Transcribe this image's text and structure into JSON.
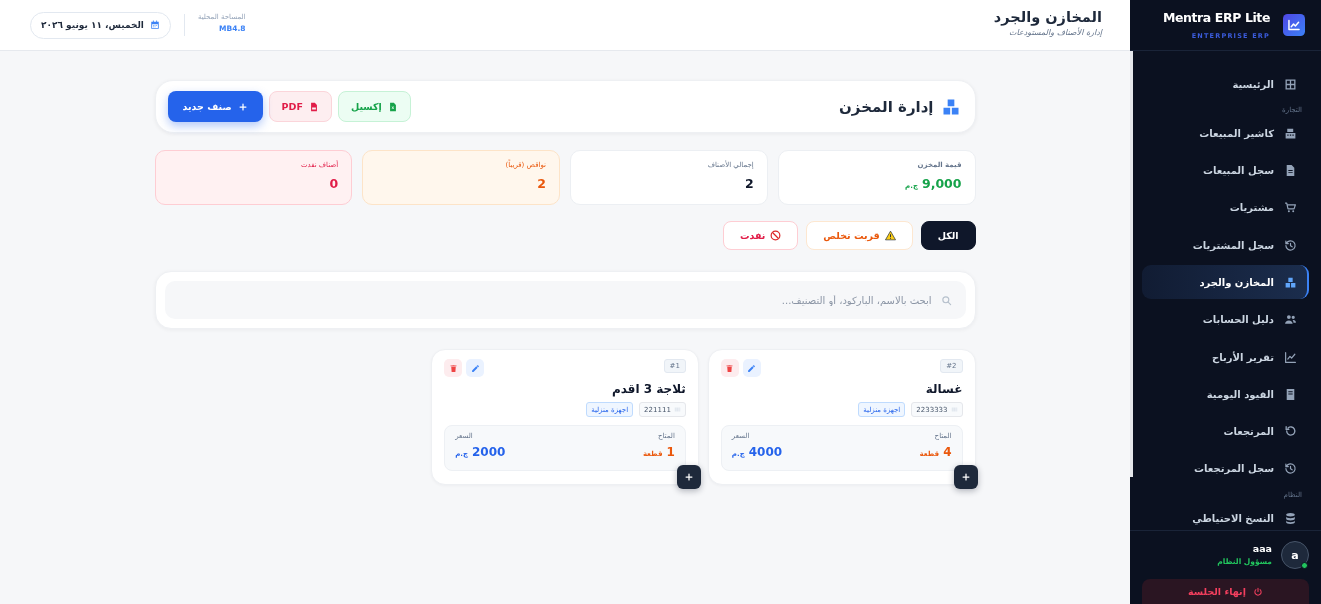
{
  "sidebar": {
    "brand": {
      "name": "Mentra ERP Lite",
      "tagline": "ENTERPRISE ERP"
    },
    "nav_groups": [
      {
        "items": [
          {
            "label": "الرئيسية",
            "selected": false
          }
        ]
      },
      {
        "title": "التجارة",
        "items": [
          {
            "label": "كاشير المبيعات",
            "selected": false
          },
          {
            "label": "سجل المبيعات",
            "selected": false
          },
          {
            "label": "مشتريات",
            "selected": false
          },
          {
            "label": "سجل المشتريات",
            "selected": false
          },
          {
            "label": "المخازن والجرد",
            "selected": true
          },
          {
            "label": "دليل الحسابات",
            "selected": false
          },
          {
            "label": "تقرير الأرباح",
            "selected": false
          },
          {
            "label": "القيود اليومية",
            "selected": false
          },
          {
            "label": "المرتجعات",
            "selected": false
          },
          {
            "label": "سجل المرتجعات",
            "selected": false
          }
        ]
      },
      {
        "title": "النظام",
        "items": [
          {
            "label": "النسخ الاحتياطي",
            "selected": false
          }
        ]
      }
    ],
    "user": {
      "name": "aaa",
      "role": "مسؤول النظام",
      "avatar_letter": "a",
      "online": true
    },
    "logout": {
      "label": "إنهاء الجلسة"
    }
  },
  "header": {
    "title": "المخازن والجرد",
    "subtitle": "إدارة الأصناف والمستودعات",
    "storage": {
      "label": "المساحة المحلية",
      "value": "MB4.8"
    },
    "date": "الخميس، ١١ يونيو ٢٠٢٦"
  },
  "page": {
    "title": "إدارة المخزن",
    "actions": [
      {
        "kind": "excel",
        "label": "إكسيل"
      },
      {
        "kind": "pdf",
        "label": "PDF"
      },
      {
        "kind": "add",
        "label": "صنف جديد"
      }
    ]
  },
  "stats": [
    {
      "kind": "value",
      "label": "قيمة المخزن",
      "value": "9,000",
      "unit": "ج.م"
    },
    {
      "kind": "total",
      "label": "إجمالي الأصناف",
      "value": "2"
    },
    {
      "kind": "low",
      "label": "نواقص (قريباً)",
      "value": "2"
    },
    {
      "kind": "out",
      "label": "أصناف نفدت",
      "value": "0"
    }
  ],
  "filters": [
    {
      "kind": "all",
      "label": "الكل",
      "selected": true
    },
    {
      "kind": "low",
      "label": "قربت تخلص",
      "selected": false
    },
    {
      "kind": "out",
      "label": "نفدت",
      "selected": false
    }
  ],
  "search": {
    "placeholder": "ابحث بالاسم، الباركود، أو التصنيف..."
  },
  "products": [
    {
      "number": "#2",
      "name": "غسالة",
      "barcode": "2233333",
      "category": "اجهزة منزلية",
      "stock_label": "المتاح",
      "stock": "4",
      "stock_unit": "قطعة",
      "low_stock": true,
      "price_label": "السعر",
      "price": "4000",
      "currency": "ج.م"
    },
    {
      "number": "#1",
      "name": "ثلاجة 3 اقدم",
      "barcode": "221111",
      "category": "اجهزة منزلية",
      "stock_label": "المتاح",
      "stock": "1",
      "stock_unit": "قطعة",
      "low_stock": true,
      "price_label": "السعر",
      "price": "2000",
      "currency": "ج.م"
    }
  ]
}
